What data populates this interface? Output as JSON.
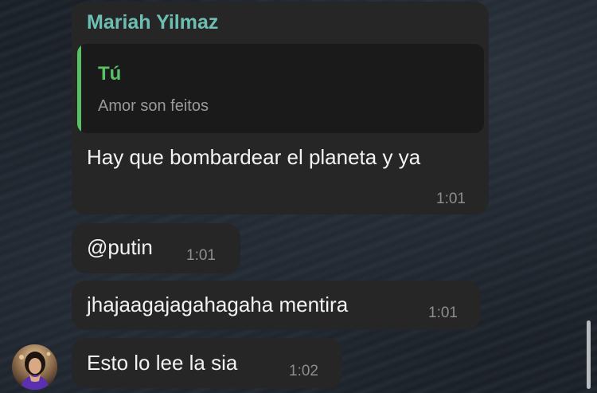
{
  "chat": {
    "sender_name": "Mariah Yilmaz",
    "reply": {
      "name": "Tú",
      "text": "Amor son feitos"
    },
    "messages": [
      {
        "text": "Hay que bombardear el planeta y ya",
        "time": "1:01"
      },
      {
        "text": "@putin",
        "time": "1:01"
      },
      {
        "text": "jhajaagajagahagaha mentira",
        "time": "1:01"
      },
      {
        "text": "Esto lo lee la sia",
        "time": "1:02"
      }
    ]
  },
  "colors": {
    "sender_name": "#6dbfb4",
    "reply_accent": "#5ac266",
    "bubble": "#262626"
  }
}
